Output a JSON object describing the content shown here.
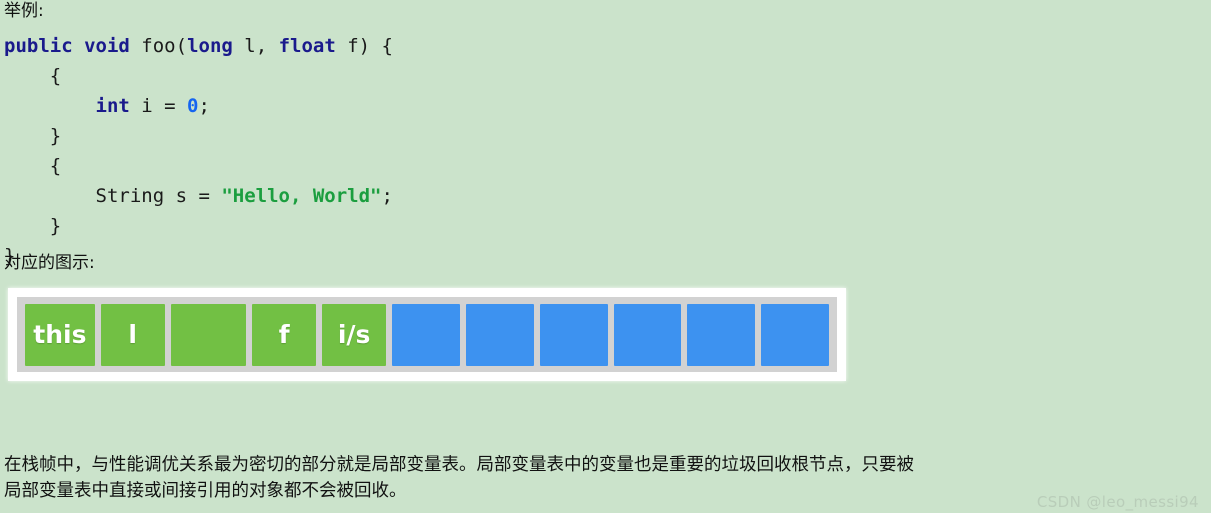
{
  "page": {
    "background_color": "#cbe3cb",
    "heading_example": "举例:",
    "heading_diagram": "对应的图示:"
  },
  "code": {
    "language": "java",
    "colors": {
      "keyword": "#1a1a8c",
      "number": "#1565f0",
      "string": "#1b9e3f",
      "plain": "#1a1a1a"
    },
    "lines": [
      {
        "id": "l1",
        "tokens": [
          {
            "t": "public",
            "c": "kw"
          },
          {
            "t": " ",
            "c": "plain"
          },
          {
            "t": "void",
            "c": "kw"
          },
          {
            "t": " foo(",
            "c": "plain"
          },
          {
            "t": "long",
            "c": "kw"
          },
          {
            "t": " l, ",
            "c": "plain"
          },
          {
            "t": "float",
            "c": "kw"
          },
          {
            "t": " f) {",
            "c": "plain"
          }
        ]
      },
      {
        "id": "l2",
        "tokens": [
          {
            "t": "    {",
            "c": "plain"
          }
        ]
      },
      {
        "id": "l3",
        "tokens": [
          {
            "t": "        ",
            "c": "plain"
          },
          {
            "t": "int",
            "c": "kw"
          },
          {
            "t": " i = ",
            "c": "plain"
          },
          {
            "t": "0",
            "c": "num"
          },
          {
            "t": ";",
            "c": "plain"
          }
        ]
      },
      {
        "id": "l4",
        "tokens": [
          {
            "t": "    }",
            "c": "plain"
          }
        ]
      },
      {
        "id": "l5",
        "tokens": [
          {
            "t": "    {",
            "c": "plain"
          }
        ]
      },
      {
        "id": "l6",
        "tokens": [
          {
            "t": "        String s = ",
            "c": "plain"
          },
          {
            "t": "\"Hello, World\"",
            "c": "str"
          },
          {
            "t": ";",
            "c": "plain"
          }
        ]
      },
      {
        "id": "l7",
        "tokens": [
          {
            "t": "    }",
            "c": "plain"
          }
        ]
      },
      {
        "id": "l8",
        "tokens": [
          {
            "t": "}",
            "c": "plain"
          }
        ]
      }
    ]
  },
  "diagram": {
    "name": "local-variable-table",
    "frame_color": "#ffffff",
    "panel_color": "#d2d2d2",
    "occupied_color": "#72c044",
    "empty_color": "#3d92f0",
    "slots": [
      {
        "label": "this",
        "state": "occupied",
        "width": "w-this"
      },
      {
        "label": "l",
        "state": "occupied",
        "width": "w-std"
      },
      {
        "label": "",
        "state": "occupied",
        "width": "w-wide"
      },
      {
        "label": "f",
        "state": "occupied",
        "width": "w-std"
      },
      {
        "label": "i/s",
        "state": "occupied",
        "width": "w-std"
      },
      {
        "label": "",
        "state": "empty",
        "width": "w-blue"
      },
      {
        "label": "",
        "state": "empty",
        "width": "w-blue"
      },
      {
        "label": "",
        "state": "empty",
        "width": "w-blue"
      },
      {
        "label": "",
        "state": "empty",
        "width": "w-blue"
      },
      {
        "label": "",
        "state": "empty",
        "width": "w-blue"
      },
      {
        "label": "",
        "state": "empty",
        "width": "w-blue"
      }
    ]
  },
  "paragraph": {
    "line1": "在栈帧中，与性能调优关系最为密切的部分就是局部变量表。局部变量表中的变量也是重要的垃圾回收根节点，只要被",
    "line2": "局部变量表中直接或间接引用的对象都不会被回收。"
  },
  "watermark": {
    "text": "CSDN @leo_messi94",
    "color": "#b9cdb9"
  }
}
